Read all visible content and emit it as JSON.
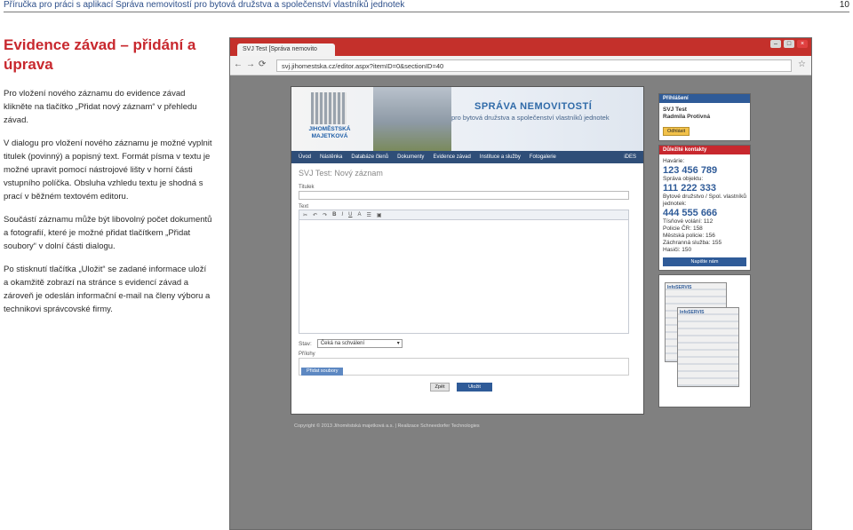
{
  "doc": {
    "header_title": "Příručka pro práci s aplikací Správa nemovitostí pro bytová družstva a společenství vlastníků jednotek",
    "page_number": "10",
    "heading_line1": "Evidence závad – přidání a",
    "heading_line2": "úprava",
    "paragraphs": [
      "Pro vložení nového záznamu do evidence závad klikněte na tlačítko „Přidat nový záznam“ v přehledu závad.",
      "V dialogu pro vložení nového záznamu je možné vyplnit titulek (povinný) a popisný text. Formát písma v textu je možné upravit pomocí nástrojové lišty v horní části vstupního políčka. Obsluha vzhledu textu je shodná s prací v běžném textovém editoru.",
      "Součástí záznamu může být libovolný počet dokumentů a fotografií, které je možné přidat tlačítkem „Přidat soubory“ v dolní části dialogu.",
      "Po stisknutí tlačítka „Uložit“ se zadané informace uloží a okamžitě zobrazí na stránce s evidencí závad a zároveň je odeslán informační e-mail na členy výboru a technikovi správcovské firmy."
    ]
  },
  "browser": {
    "tab_label": "SVJ Test [Správa nemovito",
    "url": "svj.jihomestska.cz/editor.aspx?itemID=0&sectionID=40"
  },
  "site": {
    "logo_text": "JIHOMĚSTSKÁ MAJETKOVÁ",
    "title": "SPRÁVA NEMOVITOSTÍ",
    "subtitle": "pro bytová družstva a společenství vlastníků jednotek",
    "menu": [
      "Úvod",
      "Nástěnka",
      "Databáze členů",
      "Dokumenty",
      "Evidence závad",
      "Instituce a služby",
      "Fotogalerie"
    ],
    "menu_right": "iDES",
    "form_title": "SVJ Test: Nový záznam",
    "label_title": "Titulek",
    "label_text": "Text",
    "label_stav": "Stav:",
    "stav_value": "Čeká na schválení",
    "label_prilohy": "Přílohy",
    "btn_add_files": "Přidat soubory",
    "btn_back": "Zpět",
    "btn_save": "Uložit",
    "copyright": "Copyright © 2013 Jihoměstská majetková a.s.  |  Realizace Schneedorfer Technologies"
  },
  "sidebar": {
    "login_head": "Přihlášení",
    "login_org": "SVJ Test",
    "login_user": "Radmila Protivná",
    "logout": "Odhlásit",
    "contacts_head": "Důležité kontakty",
    "havarie_label": "Havárie:",
    "havarie_num": "123 456 789",
    "sprava_label": "Správa objektu:",
    "sprava_num": "111 222 333",
    "druzstvo_label": "Bytové družstvo / Spol. vlastníků jednotek:",
    "druzstvo_num": "444 555 666",
    "lines": [
      "Tísňové volání: 112",
      "Policie ČR: 158",
      "Městská policie: 156",
      "Záchranná služba: 155",
      "Hasiči: 150"
    ],
    "write_us": "Napište nám",
    "thumb_name": "InfoSERVIS"
  }
}
